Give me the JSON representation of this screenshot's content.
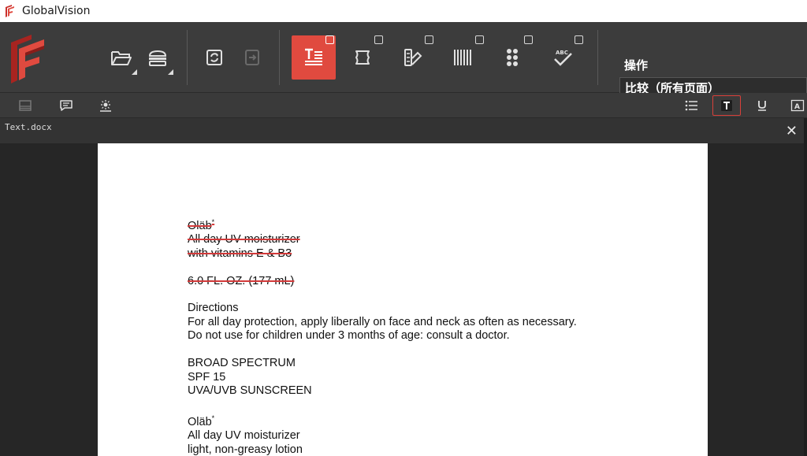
{
  "window": {
    "title": "GlobalVision"
  },
  "toolbar": {
    "buttons": [
      {
        "name": "open-icon",
        "has_dropdown": true
      },
      {
        "name": "scan-icon",
        "has_dropdown": true
      },
      {
        "name": "refresh-icon"
      },
      {
        "name": "export-icon",
        "disabled": true
      },
      {
        "name": "text-compare-icon",
        "active": true
      },
      {
        "name": "graphics-compare-icon"
      },
      {
        "name": "color-compare-icon"
      },
      {
        "name": "barcode-icon"
      },
      {
        "name": "braille-icon"
      },
      {
        "name": "spellcheck-icon"
      }
    ],
    "operations_label": "操作",
    "operations_value": "比较（所有页面）"
  },
  "subtoolbar": {
    "left": [
      "layers-icon",
      "comment-icon",
      "inspect-icon"
    ],
    "right": [
      "list-icon",
      "text-format-icon",
      "underline-icon",
      "text-box-icon"
    ],
    "selected": "text-format-icon"
  },
  "document": {
    "file_name": "Text.docx",
    "close_label": "✕",
    "paragraphs": [
      {
        "deleted": true,
        "lines": [
          {
            "text": "Oläb",
            "sup": "*"
          },
          {
            "text": "All day UV moisturizer"
          },
          {
            "text": "with vitamins E & B3"
          }
        ]
      },
      {
        "deleted": true,
        "lines": [
          {
            "text": "6.0 FL. OZ. (177 mL)"
          }
        ]
      },
      {
        "deleted": false,
        "lines": [
          {
            "text": "Directions"
          },
          {
            "text": "For all day protection, apply liberally on face and neck as often as necessary."
          },
          {
            "text": "Do not use for children under 3 months of age: consult a doctor."
          }
        ]
      },
      {
        "deleted": false,
        "lines": [
          {
            "text": "BROAD SPECTRUM"
          },
          {
            "text": "SPF 15"
          },
          {
            "text": "UVA/UVB SUNSCREEN"
          }
        ]
      },
      {
        "deleted": false,
        "lines": [
          {
            "text": "Oläb",
            "sup": "*"
          },
          {
            "text": "All day UV moisturizer"
          },
          {
            "text": "light, non-greasy lotion"
          }
        ]
      }
    ]
  },
  "colors": {
    "accent": "#e04a3f",
    "deletion": "#d23a3a",
    "toolbar": "#3c3c3c",
    "page": "#ffffff"
  }
}
